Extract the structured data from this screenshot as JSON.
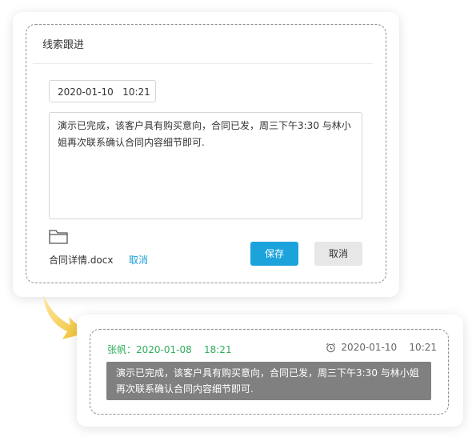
{
  "follow_up_form": {
    "title": "线索跟进",
    "datetime": "2020-01-10   10:21",
    "note": "演示已完成，该客户具有购买意向，合同已发，周三下午3:30 与林小姐再次联系确认合同内容细节即可.",
    "attachment": {
      "file_name": "合同详情.docx",
      "cancel_label": "取消"
    },
    "save_label": "保存",
    "cancel_label": "取消"
  },
  "follow_up_record": {
    "author_line": "张帆：2020-01-08    18:21",
    "reminder_time": "2020-01-10    10:21",
    "note_line1": "演示已完成，该客户具有购买意向，合同已发，周三下午3:30 与林小姐",
    "note_line2": "再次联系确认合同内容细节即可.",
    "icon": "alarm-clock-icon"
  },
  "colors": {
    "accent_blue": "#1ca3dc",
    "author_green": "#2fae5b",
    "arrow_yellow": "#f2c12e",
    "note_gray": "#808080"
  }
}
